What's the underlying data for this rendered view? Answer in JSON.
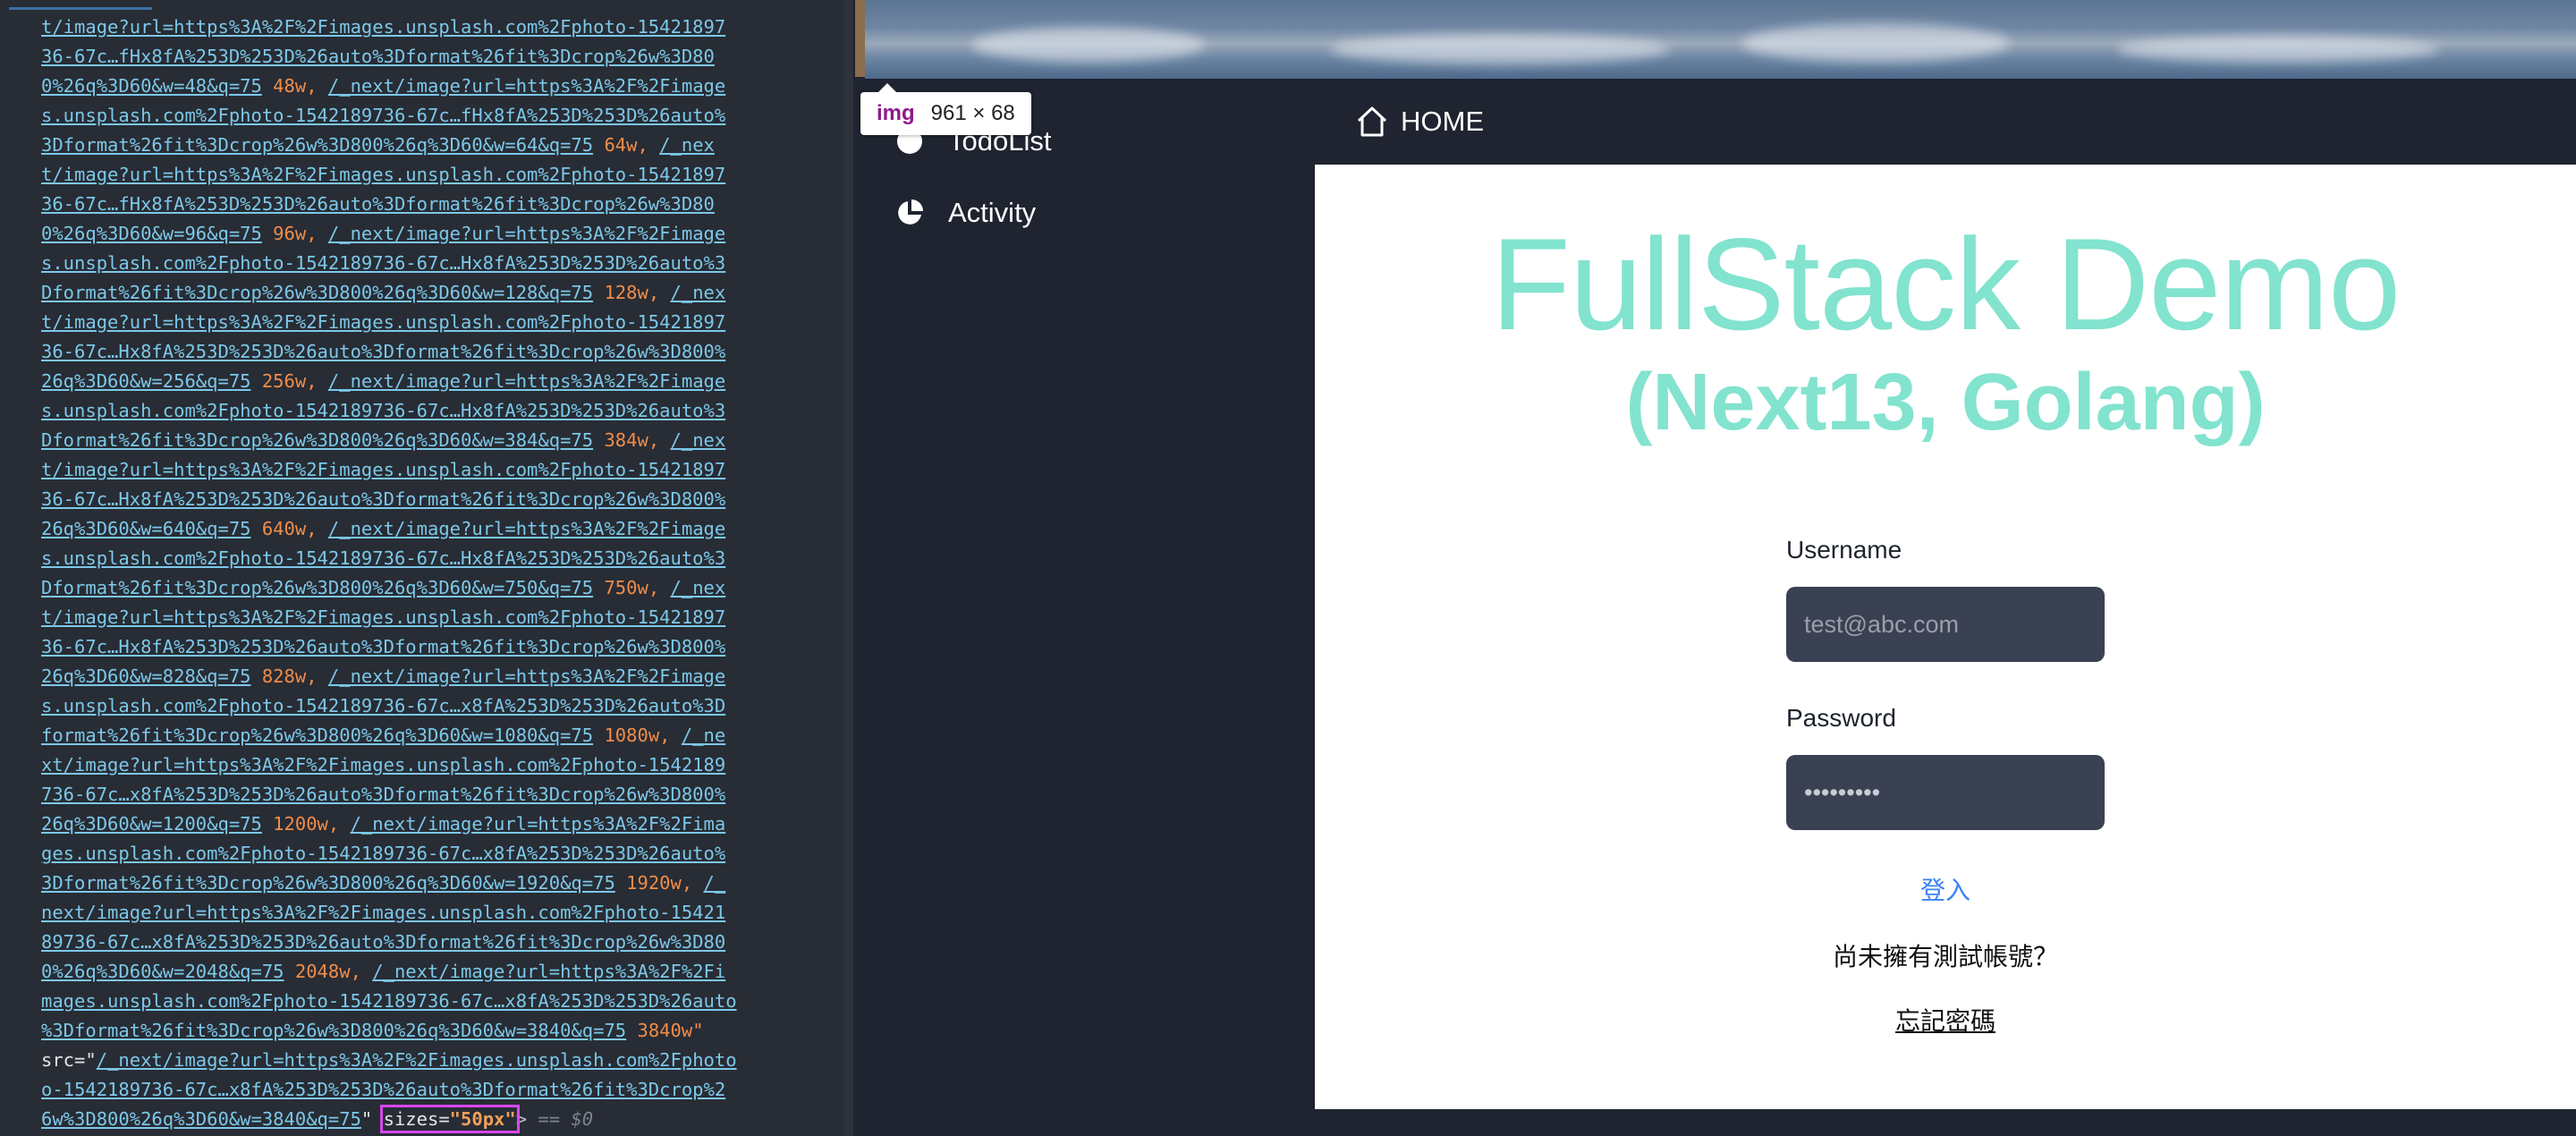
{
  "devtools": {
    "code_lines": [
      [
        "t/image?url=https%3A%2F%2Fimages.unsplash.com%2Fphoto-15421897"
      ],
      [
        "36-67c…fHx8fA%253D%253D%26auto%3Dformat%26fit%3Dcrop%26w%3D80"
      ],
      [
        "0%26q%3D60&w=48&q=75",
        " 48w, ",
        "/_next/image?url=https%3A%2F%2Fimage"
      ],
      [
        "s.unsplash.com%2Fphoto-1542189736-67c…fHx8fA%253D%253D%26auto%"
      ],
      [
        "3Dformat%26fit%3Dcrop%26w%3D800%26q%3D60&w=64&q=75",
        " 64w, ",
        "/_nex"
      ],
      [
        "t/image?url=https%3A%2F%2Fimages.unsplash.com%2Fphoto-15421897"
      ],
      [
        "36-67c…fHx8fA%253D%253D%26auto%3Dformat%26fit%3Dcrop%26w%3D80"
      ],
      [
        "0%26q%3D60&w=96&q=75",
        " 96w, ",
        "/_next/image?url=https%3A%2F%2Fimage"
      ],
      [
        "s.unsplash.com%2Fphoto-1542189736-67c…Hx8fA%253D%253D%26auto%3"
      ],
      [
        "Dformat%26fit%3Dcrop%26w%3D800%26q%3D60&w=128&q=75",
        " 128w, ",
        "/_nex"
      ],
      [
        "t/image?url=https%3A%2F%2Fimages.unsplash.com%2Fphoto-15421897"
      ],
      [
        "36-67c…Hx8fA%253D%253D%26auto%3Dformat%26fit%3Dcrop%26w%3D800%"
      ],
      [
        "26q%3D60&w=256&q=75",
        " 256w, ",
        "/_next/image?url=https%3A%2F%2Fimage"
      ],
      [
        "s.unsplash.com%2Fphoto-1542189736-67c…Hx8fA%253D%253D%26auto%3"
      ],
      [
        "Dformat%26fit%3Dcrop%26w%3D800%26q%3D60&w=384&q=75",
        " 384w, ",
        "/_nex"
      ],
      [
        "t/image?url=https%3A%2F%2Fimages.unsplash.com%2Fphoto-15421897"
      ],
      [
        "36-67c…Hx8fA%253D%253D%26auto%3Dformat%26fit%3Dcrop%26w%3D800%"
      ],
      [
        "26q%3D60&w=640&q=75",
        " 640w, ",
        "/_next/image?url=https%3A%2F%2Fimage"
      ],
      [
        "s.unsplash.com%2Fphoto-1542189736-67c…Hx8fA%253D%253D%26auto%3"
      ],
      [
        "Dformat%26fit%3Dcrop%26w%3D800%26q%3D60&w=750&q=75",
        " 750w, ",
        "/_nex"
      ],
      [
        "t/image?url=https%3A%2F%2Fimages.unsplash.com%2Fphoto-15421897"
      ],
      [
        "36-67c…Hx8fA%253D%253D%26auto%3Dformat%26fit%3Dcrop%26w%3D800%"
      ],
      [
        "26q%3D60&w=828&q=75",
        " 828w, ",
        "/_next/image?url=https%3A%2F%2Fimage"
      ],
      [
        "s.unsplash.com%2Fphoto-1542189736-67c…x8fA%253D%253D%26auto%3D"
      ],
      [
        "format%26fit%3Dcrop%26w%3D800%26q%3D60&w=1080&q=75",
        " 1080w, ",
        "/_ne"
      ],
      [
        "xt/image?url=https%3A%2F%2Fimages.unsplash.com%2Fphoto-1542189"
      ],
      [
        "736-67c…x8fA%253D%253D%26auto%3Dformat%26fit%3Dcrop%26w%3D800%"
      ],
      [
        "26q%3D60&w=1200&q=75",
        " 1200w, ",
        "/_next/image?url=https%3A%2F%2Fima"
      ],
      [
        "ges.unsplash.com%2Fphoto-1542189736-67c…x8fA%253D%253D%26auto%"
      ],
      [
        "3Dformat%26fit%3Dcrop%26w%3D800%26q%3D60&w=1920&q=75",
        " 1920w, ",
        "/_"
      ],
      [
        "next/image?url=https%3A%2F%2Fimages.unsplash.com%2Fphoto-15421"
      ],
      [
        "89736-67c…x8fA%253D%253D%26auto%3Dformat%26fit%3Dcrop%26w%3D80"
      ],
      [
        "0%26q%3D60&w=2048&q=75",
        " 2048w, ",
        "/_next/image?url=https%3A%2F%2Fi"
      ],
      [
        "mages.unsplash.com%2Fphoto-1542189736-67c…x8fA%253D%253D%26auto"
      ],
      [
        "%3Dformat%26fit%3Dcrop%26w%3D800%26q%3D60&w=3840&q=75",
        " 3840w\""
      ],
      [
        "src=\"",
        "/_next/image?url=https%3A%2F%2Fimages.unsplash.com%2Fphoto"
      ],
      [
        "o-1542189736-67c…x8fA%253D%253D%26auto%3Dformat%26fit%3Dcrop%2"
      ]
    ],
    "last_line_url": "6w%3D800%26q%3D60&w=3840&q=75",
    "last_line_quote": "\" ",
    "sizes_attr": "sizes=",
    "sizes_value": "\"50px\"",
    "sizes_close": ">",
    "console_ref": " == $0"
  },
  "tooltip": {
    "tag": "img",
    "dimensions": "961 × 68"
  },
  "sidebar": {
    "items": [
      {
        "label": "TodoList",
        "icon": "circle-icon"
      },
      {
        "label": "Activity",
        "icon": "pie-chart-icon"
      }
    ]
  },
  "topbar": {
    "home_label": "HOME",
    "home_icon": "home-icon"
  },
  "main": {
    "title": "FullStack Demo",
    "subtitle": "(Next13, Golang)",
    "username_label": "Username",
    "username_placeholder": "test@abc.com",
    "password_label": "Password",
    "password_value": "•••••••••",
    "login_label": "登入",
    "no_account_text": "尚未擁有測試帳號？",
    "forgot_label": "忘記密碼"
  },
  "colors": {
    "accent_title": "#82e3ce",
    "link": "#3b82f6",
    "sidebar_bg": "#1f2430",
    "highlight": "#d946ef"
  }
}
